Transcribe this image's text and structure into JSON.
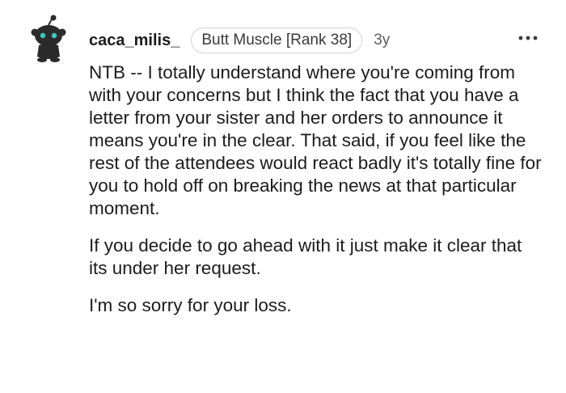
{
  "comment": {
    "username": "caca_milis_",
    "flair": "Butt Muscle [Rank 38]",
    "age": "3y",
    "paragraphs": [
      "NTB -- I totally understand where you're coming from with your concerns but I think the fact that you have a letter from your sister and her orders to announce it means you're in the clear. That said, if you feel like the rest of the attendees would react badly it's totally fine for you to hold off on breaking the news at that particular moment.",
      "If you decide to go ahead with it just make it clear that its under her request.",
      "I'm so sorry for your loss."
    ],
    "more_icon": "ellipsis-icon",
    "avatar_icon": "snoo-avatar-icon"
  },
  "colors": {
    "text": "#1c1c1c",
    "muted": "#5c5c5c",
    "flair_border": "#cfd3d6",
    "avatar_body": "#2b2b2b",
    "avatar_eyes": "#3ec7c2"
  }
}
